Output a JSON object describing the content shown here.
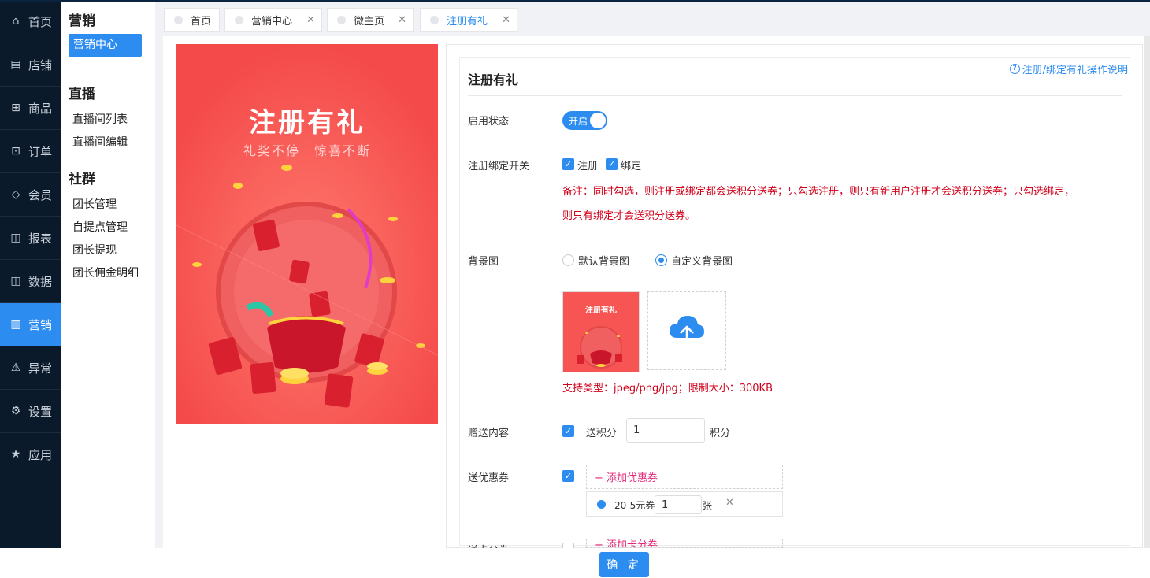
{
  "nav": {
    "items": [
      {
        "label": "首页",
        "icon": "home-icon",
        "glyph": "⌂"
      },
      {
        "label": "店铺",
        "icon": "store-icon",
        "glyph": "▤"
      },
      {
        "label": "商品",
        "icon": "gift-icon",
        "glyph": "⊞"
      },
      {
        "label": "订单",
        "icon": "order-icon",
        "glyph": "⊡"
      },
      {
        "label": "会员",
        "icon": "diamond-icon",
        "glyph": "◇"
      },
      {
        "label": "报表",
        "icon": "bag-icon",
        "glyph": "◫"
      },
      {
        "label": "数据",
        "icon": "lock-icon",
        "glyph": "◫"
      },
      {
        "label": "营销",
        "icon": "bar-chart-icon",
        "glyph": "▥",
        "active": true
      },
      {
        "label": "异常",
        "icon": "warning-icon",
        "glyph": "⚠"
      },
      {
        "label": "设置",
        "icon": "gear-icon",
        "glyph": "⚙"
      },
      {
        "label": "应用",
        "icon": "star-icon",
        "glyph": "★"
      }
    ]
  },
  "submenu": {
    "groups": [
      {
        "title": "营销",
        "items": [
          "营销中心"
        ]
      },
      {
        "title": "直播",
        "items": [
          "直播间列表",
          "直播间编辑"
        ]
      },
      {
        "title": "社群",
        "items": [
          "团长管理",
          "自提点管理",
          "团长提现",
          "团长佣金明细"
        ]
      }
    ]
  },
  "tabs": [
    {
      "label": "首页",
      "closable": false
    },
    {
      "label": "营销中心",
      "closable": true
    },
    {
      "label": "微主页",
      "closable": true
    },
    {
      "label": "注册有礼",
      "closable": true,
      "active": true
    }
  ],
  "poster": {
    "title": "注册有礼",
    "subtitle": "礼奖不停　惊喜不断"
  },
  "form": {
    "title": "注册有礼",
    "help_link": "注册/绑定有礼操作说明",
    "status_label": "启用状态",
    "status_switch": "开启",
    "bind_label": "注册绑定开关",
    "bind_register": "注册",
    "bind_bind": "绑定",
    "note_line1": "备注：同时勾选，则注册或绑定都会送积分送券；只勾选注册，则只有新用户注册才会送积分送券；只勾选绑定，",
    "note_line2": "则只有绑定才会送积分送券。",
    "bg_label": "背景图",
    "bg_default": "默认背景图",
    "bg_custom": "自定义背景图",
    "thumb_title": "注册有礼",
    "upload_hint": "支持类型：jpeg/png/jpg；限制大小：300KB",
    "gift_label": "赠送内容",
    "gift_points_label": "送积分",
    "gift_points_value": "1",
    "gift_points_unit": "积分",
    "coupon_label": "送优惠券",
    "coupon_add": "+ 添加优惠券",
    "coupon_item_name": "20-5元券",
    "coupon_item_qty": "1",
    "coupon_item_unit": "张",
    "card_label": "送卡分券",
    "card_add": "+ 添加卡分券"
  },
  "footer": {
    "ok": "确 定"
  },
  "colors": {
    "primary": "#2d8cf0",
    "nav_bg": "#0b1a2b",
    "danger": "#d0021b",
    "poster": "#f75454"
  }
}
